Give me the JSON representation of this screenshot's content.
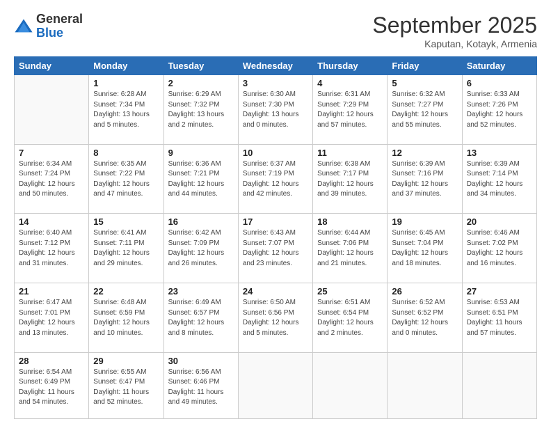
{
  "header": {
    "logo": {
      "general": "General",
      "blue": "Blue"
    },
    "month": "September 2025",
    "location": "Kaputan, Kotayk, Armenia"
  },
  "weekdays": [
    "Sunday",
    "Monday",
    "Tuesday",
    "Wednesday",
    "Thursday",
    "Friday",
    "Saturday"
  ],
  "weeks": [
    [
      {
        "day": "",
        "info": ""
      },
      {
        "day": "1",
        "info": "Sunrise: 6:28 AM\nSunset: 7:34 PM\nDaylight: 13 hours\nand 5 minutes."
      },
      {
        "day": "2",
        "info": "Sunrise: 6:29 AM\nSunset: 7:32 PM\nDaylight: 13 hours\nand 2 minutes."
      },
      {
        "day": "3",
        "info": "Sunrise: 6:30 AM\nSunset: 7:30 PM\nDaylight: 13 hours\nand 0 minutes."
      },
      {
        "day": "4",
        "info": "Sunrise: 6:31 AM\nSunset: 7:29 PM\nDaylight: 12 hours\nand 57 minutes."
      },
      {
        "day": "5",
        "info": "Sunrise: 6:32 AM\nSunset: 7:27 PM\nDaylight: 12 hours\nand 55 minutes."
      },
      {
        "day": "6",
        "info": "Sunrise: 6:33 AM\nSunset: 7:26 PM\nDaylight: 12 hours\nand 52 minutes."
      }
    ],
    [
      {
        "day": "7",
        "info": "Sunrise: 6:34 AM\nSunset: 7:24 PM\nDaylight: 12 hours\nand 50 minutes."
      },
      {
        "day": "8",
        "info": "Sunrise: 6:35 AM\nSunset: 7:22 PM\nDaylight: 12 hours\nand 47 minutes."
      },
      {
        "day": "9",
        "info": "Sunrise: 6:36 AM\nSunset: 7:21 PM\nDaylight: 12 hours\nand 44 minutes."
      },
      {
        "day": "10",
        "info": "Sunrise: 6:37 AM\nSunset: 7:19 PM\nDaylight: 12 hours\nand 42 minutes."
      },
      {
        "day": "11",
        "info": "Sunrise: 6:38 AM\nSunset: 7:17 PM\nDaylight: 12 hours\nand 39 minutes."
      },
      {
        "day": "12",
        "info": "Sunrise: 6:39 AM\nSunset: 7:16 PM\nDaylight: 12 hours\nand 37 minutes."
      },
      {
        "day": "13",
        "info": "Sunrise: 6:39 AM\nSunset: 7:14 PM\nDaylight: 12 hours\nand 34 minutes."
      }
    ],
    [
      {
        "day": "14",
        "info": "Sunrise: 6:40 AM\nSunset: 7:12 PM\nDaylight: 12 hours\nand 31 minutes."
      },
      {
        "day": "15",
        "info": "Sunrise: 6:41 AM\nSunset: 7:11 PM\nDaylight: 12 hours\nand 29 minutes."
      },
      {
        "day": "16",
        "info": "Sunrise: 6:42 AM\nSunset: 7:09 PM\nDaylight: 12 hours\nand 26 minutes."
      },
      {
        "day": "17",
        "info": "Sunrise: 6:43 AM\nSunset: 7:07 PM\nDaylight: 12 hours\nand 23 minutes."
      },
      {
        "day": "18",
        "info": "Sunrise: 6:44 AM\nSunset: 7:06 PM\nDaylight: 12 hours\nand 21 minutes."
      },
      {
        "day": "19",
        "info": "Sunrise: 6:45 AM\nSunset: 7:04 PM\nDaylight: 12 hours\nand 18 minutes."
      },
      {
        "day": "20",
        "info": "Sunrise: 6:46 AM\nSunset: 7:02 PM\nDaylight: 12 hours\nand 16 minutes."
      }
    ],
    [
      {
        "day": "21",
        "info": "Sunrise: 6:47 AM\nSunset: 7:01 PM\nDaylight: 12 hours\nand 13 minutes."
      },
      {
        "day": "22",
        "info": "Sunrise: 6:48 AM\nSunset: 6:59 PM\nDaylight: 12 hours\nand 10 minutes."
      },
      {
        "day": "23",
        "info": "Sunrise: 6:49 AM\nSunset: 6:57 PM\nDaylight: 12 hours\nand 8 minutes."
      },
      {
        "day": "24",
        "info": "Sunrise: 6:50 AM\nSunset: 6:56 PM\nDaylight: 12 hours\nand 5 minutes."
      },
      {
        "day": "25",
        "info": "Sunrise: 6:51 AM\nSunset: 6:54 PM\nDaylight: 12 hours\nand 2 minutes."
      },
      {
        "day": "26",
        "info": "Sunrise: 6:52 AM\nSunset: 6:52 PM\nDaylight: 12 hours\nand 0 minutes."
      },
      {
        "day": "27",
        "info": "Sunrise: 6:53 AM\nSunset: 6:51 PM\nDaylight: 11 hours\nand 57 minutes."
      }
    ],
    [
      {
        "day": "28",
        "info": "Sunrise: 6:54 AM\nSunset: 6:49 PM\nDaylight: 11 hours\nand 54 minutes."
      },
      {
        "day": "29",
        "info": "Sunrise: 6:55 AM\nSunset: 6:47 PM\nDaylight: 11 hours\nand 52 minutes."
      },
      {
        "day": "30",
        "info": "Sunrise: 6:56 AM\nSunset: 6:46 PM\nDaylight: 11 hours\nand 49 minutes."
      },
      {
        "day": "",
        "info": ""
      },
      {
        "day": "",
        "info": ""
      },
      {
        "day": "",
        "info": ""
      },
      {
        "day": "",
        "info": ""
      }
    ]
  ]
}
